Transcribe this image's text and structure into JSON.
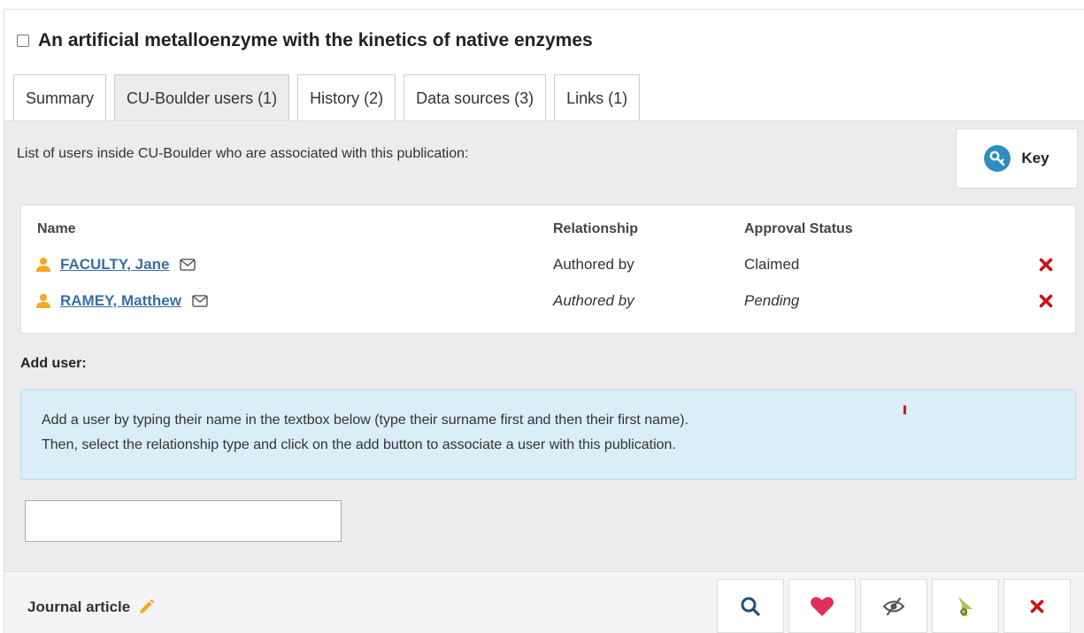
{
  "publication": {
    "title": "An artificial metalloenzyme with the kinetics of native enzymes"
  },
  "tabs": [
    {
      "label": "Summary"
    },
    {
      "label": "CU-Boulder users (1)"
    },
    {
      "label": "History (2)"
    },
    {
      "label": "Data sources (3)"
    },
    {
      "label": "Links (1)"
    }
  ],
  "active_tab_index": 1,
  "intro_text": "List of users inside CU-Boulder who are associated with this publication:",
  "key_button": {
    "label": "Key",
    "icon": "key-icon"
  },
  "users_table": {
    "headers": {
      "name": "Name",
      "relationship": "Relationship",
      "approval": "Approval Status"
    },
    "rows": [
      {
        "name": "FACULTY, Jane",
        "relationship": "Authored by",
        "status": "Claimed",
        "pending": false
      },
      {
        "name": "RAMEY, Matthew",
        "relationship": "Authored by",
        "status": "Pending",
        "pending": true
      }
    ]
  },
  "add_user": {
    "label": "Add user:",
    "info_line1": "Add a user by typing their name in the textbox below (type their surname first and then their first name).",
    "info_line2": "Then, select the relationship type and click on the add button to associate a user with this publication.",
    "input_value": "",
    "input_placeholder": ""
  },
  "footer": {
    "doc_type": "Journal article",
    "actions": [
      "search-icon",
      "heart-icon",
      "hide-icon",
      "share-icon",
      "close-icon"
    ]
  },
  "colors": {
    "accent": "#2d8dbf",
    "link": "#3a6ea5",
    "user_icon": "#f5a623",
    "delete": "#cc1111",
    "heart": "#e0305a",
    "info_bg": "#daeef7"
  }
}
